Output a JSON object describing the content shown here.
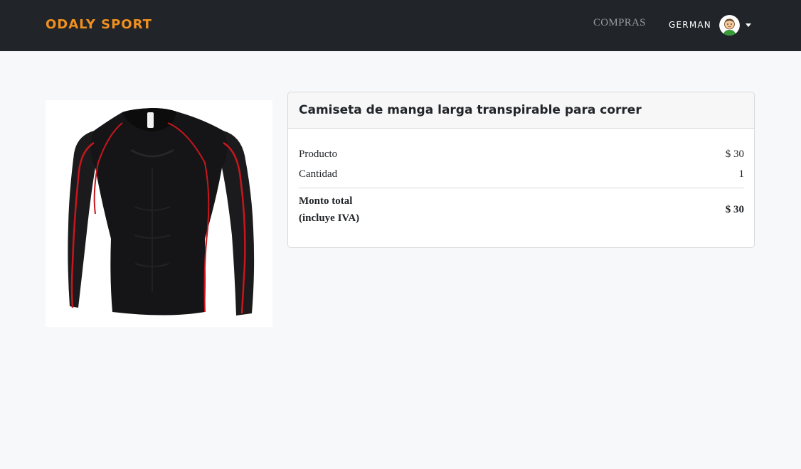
{
  "navbar": {
    "brand": "ODALY SPORT",
    "links": {
      "compras": "COMPRAS"
    },
    "user": {
      "name": "GERMAN",
      "avatar_icon": "user-avatar-icon"
    }
  },
  "product": {
    "image_icon": "long-sleeve-shirt-image",
    "title": "Camiseta de manga larga transpirable para correr",
    "rows": [
      {
        "label": "Producto",
        "value": "$ 30"
      },
      {
        "label": "Cantidad",
        "value": "1"
      }
    ],
    "total": {
      "label_line1": "Monto total",
      "label_line2": "(incluye IVA)",
      "value": "$ 30"
    }
  },
  "colors": {
    "navbar_bg": "#212429",
    "brand": "#f0901e",
    "page_bg": "#f7f8fa"
  }
}
